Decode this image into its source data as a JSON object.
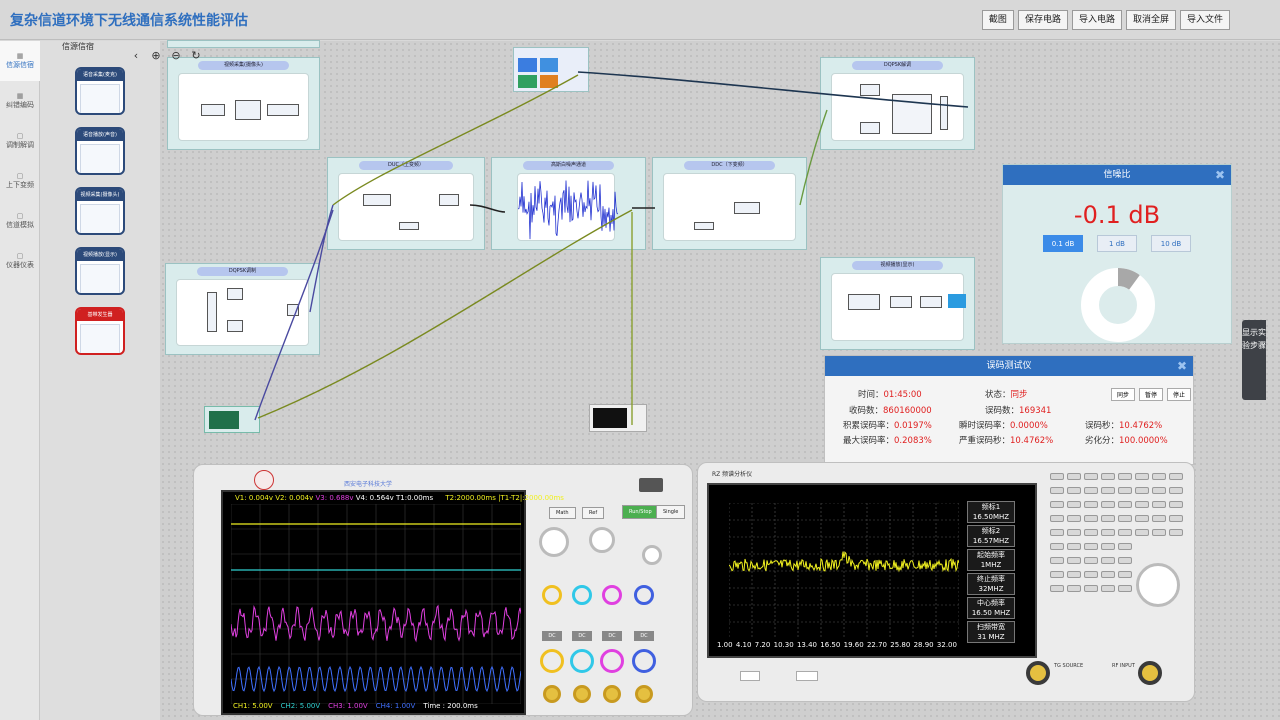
{
  "app": {
    "title": "复杂信道环境下无线通信系统性能评估"
  },
  "toolbar": {
    "buttons": [
      "截图",
      "保存电路",
      "导入电路",
      "取消全屏",
      "导入文件"
    ]
  },
  "nav": {
    "items": [
      "信源信宿",
      "纠错编码",
      "调制解调",
      "上下变频",
      "信道模拟",
      "仪器仪表"
    ]
  },
  "library": {
    "title": "信源信宿",
    "cards": [
      "语音采集(麦克)",
      "语音播放(声音)",
      "视频采集(摄像头)",
      "视频播放(显示)",
      "基带发生器"
    ]
  },
  "canvas": {
    "modules": {
      "source": "视频采集(摄像头)",
      "dqpsk_mod": "DQPSK调制",
      "duc": "DUC（上变频）",
      "noise": "高斯白噪声通道",
      "ddc": "DDC（下变频）",
      "dqpsk_demod": "DQPSK解调",
      "sink": "视频播放(显示)"
    }
  },
  "snr": {
    "title": "信噪比",
    "value": "-0.1 dB",
    "steps": [
      "0.1 dB",
      "1 dB",
      "10 dB"
    ],
    "selected": "0.1 dB",
    "gauge_fraction": 0.1
  },
  "ber": {
    "title": "误码测试仪",
    "buttons": [
      "同步",
      "暂停",
      "停止"
    ],
    "fields": [
      {
        "label": "时间：",
        "value": "01:45:00"
      },
      {
        "label": "状态：",
        "value": "同步"
      },
      {
        "label": "收码数：",
        "value": "860160000"
      },
      {
        "label": "误码数：",
        "value": "169341"
      },
      {
        "label": "积累误码率：",
        "value": "0.0197%"
      },
      {
        "label": "瞬时误码率：",
        "value": "0.0000%"
      },
      {
        "label": "误码秒：",
        "value": "10.4762%"
      },
      {
        "label": "最大误码率：",
        "value": "0.2083%"
      },
      {
        "label": "严重误码秒：",
        "value": "10.4762%"
      },
      {
        "label": "劣化分：",
        "value": "100.0000%"
      }
    ]
  },
  "side_tab": {
    "label": "显示实验步骤"
  },
  "oscilloscope": {
    "brand": "西安电子科技大学",
    "top_readouts": [
      "V1: 0.004v",
      "V2: 0.004v",
      "V3: 0.688v",
      "V4: 0.564v",
      "T1:0.00ms",
      "T2:2000.00ms",
      "|T1-T2|:2000.00ms"
    ],
    "bottom_readouts": [
      "CH1:  5.00V",
      "CH2:  5.00V",
      "CH3:  1.00V",
      "CH4:  1.00V",
      "Time : 200.0ms"
    ],
    "dc_labels": [
      "DC",
      "DC",
      "DC",
      "DC"
    ],
    "channel_colors": [
      "#f0f020",
      "#30d0d0",
      "#e040e0",
      "#4070ff"
    ],
    "buttons": [
      "Math",
      "Ref",
      "Run/Stop",
      "Single"
    ]
  },
  "spectrum": {
    "model": "RZ 频谱分析仪",
    "softkeys": [
      {
        "name": "频标1",
        "value": "16.50MHZ"
      },
      {
        "name": "频标2",
        "value": "16.57MHZ"
      },
      {
        "name": "起始频率",
        "value": "1MHZ"
      },
      {
        "name": "终止频率",
        "value": "32MHZ"
      },
      {
        "name": "中心频率",
        "value": "16.50 MHZ"
      },
      {
        "name": "扫频带宽",
        "value": "31 MHZ"
      }
    ],
    "x_ticks": [
      "1.00",
      "4.10",
      "7.20",
      "10.30",
      "13.40",
      "16.50",
      "19.60",
      "22.70",
      "25.80",
      "28.90",
      "32.00"
    ],
    "ports": [
      "TG SOURCE",
      "RF INPUT"
    ]
  }
}
